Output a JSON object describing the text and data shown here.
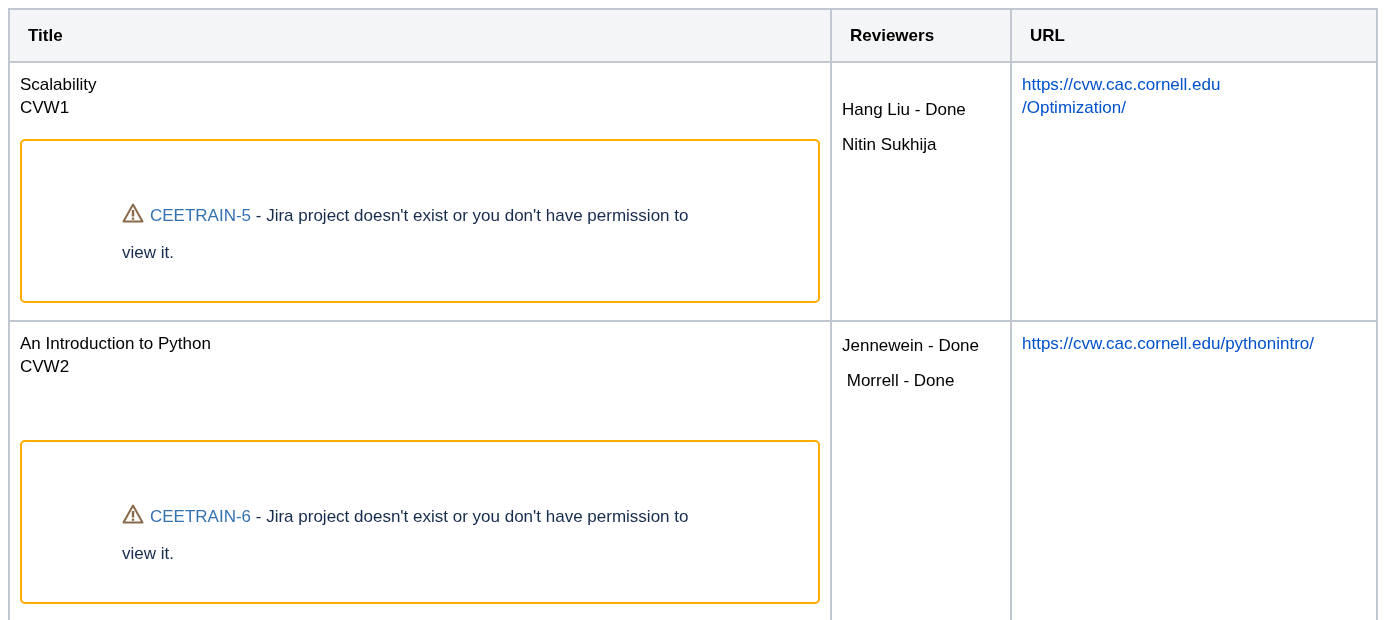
{
  "table": {
    "columns": [
      "Title",
      "Reviewers",
      "URL"
    ],
    "rows": [
      {
        "title": "Scalability",
        "code": "CVW1",
        "issue": {
          "key": "CEETRAIN-5",
          "message": " - Jira project doesn't exist or you don't have permission to view it."
        },
        "reviewers": [
          "Hang Liu - Done",
          "Nitin Sukhija"
        ],
        "url": [
          "https://cvw.cac.cornell.edu",
          "/Optimization/"
        ]
      },
      {
        "title": "An Introduction to Python",
        "code": "CVW2",
        "issue": {
          "key": "CEETRAIN-6",
          "message": " - Jira project doesn't exist or you don't have permission to view it."
        },
        "reviewers": [
          "Jennewein - Done",
          " Morrell - Done"
        ],
        "url": [
          "https://cvw.cac.cornell.edu/pythonintro/"
        ]
      }
    ]
  }
}
